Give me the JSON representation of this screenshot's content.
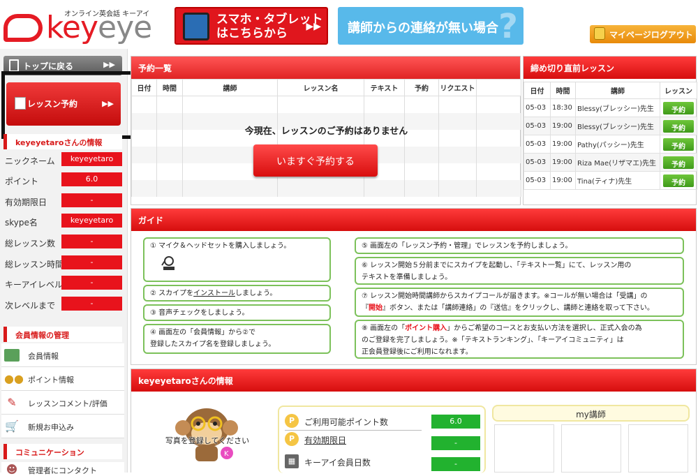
{
  "header": {
    "logo_sub": "オンライン英会話 キーアイ",
    "logo_word_a": "key",
    "logo_word_b": "eye",
    "banner_mobile_line1": "スマホ・タブレット",
    "banner_mobile_line2": "はこちらから",
    "banner_contact": "講師からの連絡が無い場合",
    "banner_contact_q": "?",
    "logout": "マイページログアウト"
  },
  "sidebar": {
    "top_button": "トップに戻る",
    "reserve_button": "レッスン予約",
    "arrow": "▶▶",
    "user_info_head": "keyeyetaroさんの情報",
    "info": [
      {
        "label": "ニックネーム",
        "value": "keyeyetaro"
      },
      {
        "label": "ポイント",
        "value": "6.0"
      },
      {
        "label": "有効期限日",
        "value": "-"
      },
      {
        "label": "skype名",
        "value": "keyeyetaro"
      },
      {
        "label": "総レッスン数",
        "value": "-"
      },
      {
        "label": "総レッスン時間",
        "value": "-"
      },
      {
        "label": "キーアイレベル",
        "value": "-"
      },
      {
        "label": "次レベルまで",
        "value": "-"
      }
    ],
    "member_head": "会員情報の管理",
    "menu": [
      {
        "label": "会員情報",
        "icon": "member-card-icon"
      },
      {
        "label": "ポイント情報",
        "icon": "coins-icon"
      },
      {
        "label": "レッスンコメント/評価",
        "icon": "pencil-note-icon"
      },
      {
        "label": "新規お申込み",
        "icon": "cart-icon"
      }
    ],
    "community_head": "コミュニケーション",
    "community_item": "管理者にコンタクト"
  },
  "reservations": {
    "title": "予約一覧",
    "columns": [
      "日付",
      "時間",
      "講師",
      "レッスン名",
      "テキスト",
      "予約",
      "リクエスト"
    ],
    "empty_message": "今現在、レッスンのご予約はありません",
    "book_now": "いますぐ予約する"
  },
  "deadline": {
    "title": "締め切り直前レッスン",
    "columns": [
      "日付",
      "時間",
      "講師",
      "レッスン"
    ],
    "rows": [
      {
        "date": "05-03",
        "time": "18:30",
        "teacher": "Blessy(ブレッシー)先生",
        "action": "予約"
      },
      {
        "date": "05-03",
        "time": "19:00",
        "teacher": "Blessy(ブレッシー)先生",
        "action": "予約"
      },
      {
        "date": "05-03",
        "time": "19:00",
        "teacher": "Pathy(パッシー)先生",
        "action": "予約"
      },
      {
        "date": "05-03",
        "time": "19:00",
        "teacher": "Riza Mae(リザマエ)先生",
        "action": "予約"
      },
      {
        "date": "05-03",
        "time": "19:00",
        "teacher": "Tina(ティナ)先生",
        "action": "予約"
      }
    ]
  },
  "guide": {
    "title": "ガイド",
    "step1": "① マイク＆ヘッドセットを購入しましょう。",
    "step2_a": "② スカイプを",
    "step2_link": "インストール",
    "step2_b": "しましょう。",
    "step3": "③ 音声チェックをしましょう。",
    "step4_line1": "④ 画面左の「会員情報」から②で",
    "step4_line2": "登録したスカイプ名を登録しましょう。",
    "step5": "⑤ 画面左の「レッスン予約・管理」でレッスンを予約しましょう。",
    "step6_line1": "⑥ レッスン開始５分前までにスカイプを起動し、「テキスト一覧」にて、レッスン用の",
    "step6_line2": "テキストを準備しましょう。",
    "step7_line1": "⑦ レッスン開始時間講師からスカイプコールが届きます。※コールが無い場合は「受講」の",
    "step7_l2a": "『",
    "step7_l2b": "開始",
    "step7_l2c": "』ボタン、または「講師連絡」の『送信』をクリックし、講師と連絡を取って下さい。",
    "step8_l1a": "⑧ 画面左の「",
    "step8_l1b": "ポイント購入",
    "step8_l1c": "」からご希望のコースとお支払い方法を選択し、正式入会の為",
    "step8_line2": "のご登録を完了しましょう。※「テキストランキング」、「キーアイコミュニティ」は",
    "step8_line3": "正会員登録後にご利用になれます。"
  },
  "user_panel": {
    "title": "keyeyetaroさんの情報",
    "photo_text": "写真を登録してください",
    "points_label": "ご利用可能ポイント数",
    "points_value": "6.0",
    "expiry_label": "有効期限日",
    "expiry_value": "-",
    "days_label": "キーアイ会員日数",
    "days_value": "-",
    "my_teacher": "my講師"
  },
  "colors": {
    "brand_red": "#e51b24",
    "accent_green": "#22b22f",
    "sky": "#58b9ea",
    "orange": "#f0a020"
  }
}
